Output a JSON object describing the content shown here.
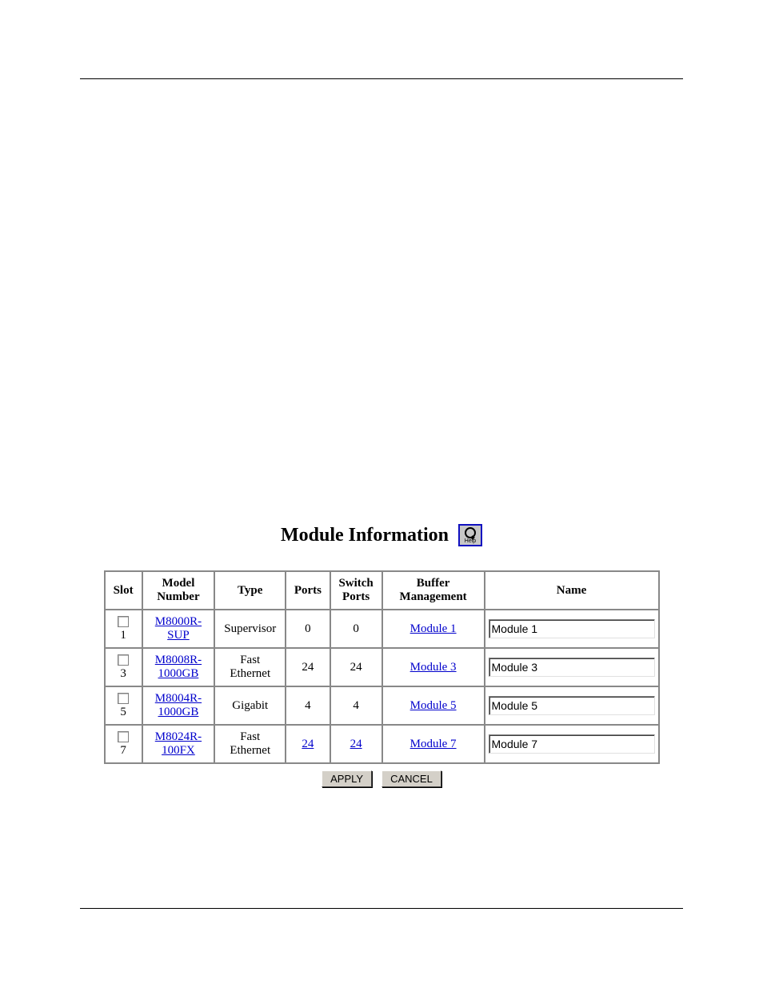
{
  "title": "Module Information",
  "help_label": "Help",
  "headers": {
    "slot": "Slot",
    "model": "Model Number",
    "type": "Type",
    "ports": "Ports",
    "switch_ports": "Switch Ports",
    "buffer": "Buffer Management",
    "name": "Name"
  },
  "rows": [
    {
      "slot": "1",
      "model": "M8000R-SUP",
      "type": "Supervisor",
      "ports": "0",
      "ports_is_link": false,
      "switch_ports": "0",
      "switch_ports_is_link": false,
      "buffer": "Module 1",
      "name_value": "Module 1"
    },
    {
      "slot": "3",
      "model": "M8008R-1000GB",
      "type": "Fast Ethernet",
      "ports": "24",
      "ports_is_link": false,
      "switch_ports": "24",
      "switch_ports_is_link": false,
      "buffer": "Module 3",
      "name_value": "Module 3"
    },
    {
      "slot": "5",
      "model": "M8004R-1000GB",
      "type": "Gigabit",
      "ports": "4",
      "ports_is_link": false,
      "switch_ports": "4",
      "switch_ports_is_link": false,
      "buffer": "Module 5",
      "name_value": "Module 5"
    },
    {
      "slot": "7",
      "model": "M8024R-100FX",
      "type": "Fast Ethernet",
      "ports": "24",
      "ports_is_link": true,
      "switch_ports": "24",
      "switch_ports_is_link": true,
      "buffer": "Module 7",
      "name_value": "Module 7"
    }
  ],
  "buttons": {
    "apply": "APPLY",
    "cancel": "CANCEL"
  }
}
